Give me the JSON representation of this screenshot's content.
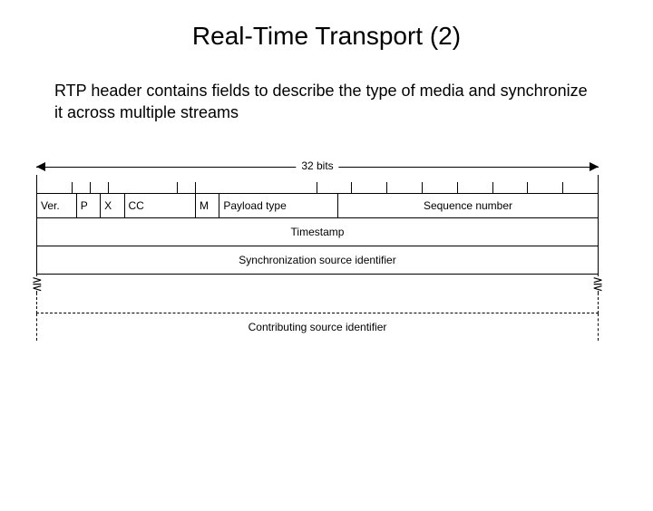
{
  "title": "Real-Time Transport (2)",
  "description": "RTP header contains fields to describe the type of media and synchronize it across multiple streams",
  "width_label": "32 bits",
  "fields": {
    "ver": "Ver.",
    "p": "P",
    "x": "X",
    "cc": "CC",
    "m": "M",
    "payload_type": "Payload type",
    "sequence_number": "Sequence number"
  },
  "rows": {
    "timestamp": "Timestamp",
    "sync_src": "Synchronization source identifier",
    "contrib_src": "Contributing source identifier"
  },
  "bit_widths": {
    "ver": 2,
    "p": 1,
    "x": 1,
    "cc": 4,
    "m": 1,
    "payload_type": 7,
    "sequence_number": 16,
    "total": 32
  },
  "chart_data": {
    "type": "table",
    "title": "RTP fixed header layout (32-bit words)",
    "word0_fields": [
      {
        "name": "Ver.",
        "bits": 2
      },
      {
        "name": "P",
        "bits": 1
      },
      {
        "name": "X",
        "bits": 1
      },
      {
        "name": "CC",
        "bits": 4
      },
      {
        "name": "M",
        "bits": 1
      },
      {
        "name": "Payload type",
        "bits": 7
      },
      {
        "name": "Sequence number",
        "bits": 16
      }
    ],
    "word1": "Timestamp",
    "word2": "Synchronization source identifier",
    "trailing_variable": "Contributing source identifier"
  }
}
